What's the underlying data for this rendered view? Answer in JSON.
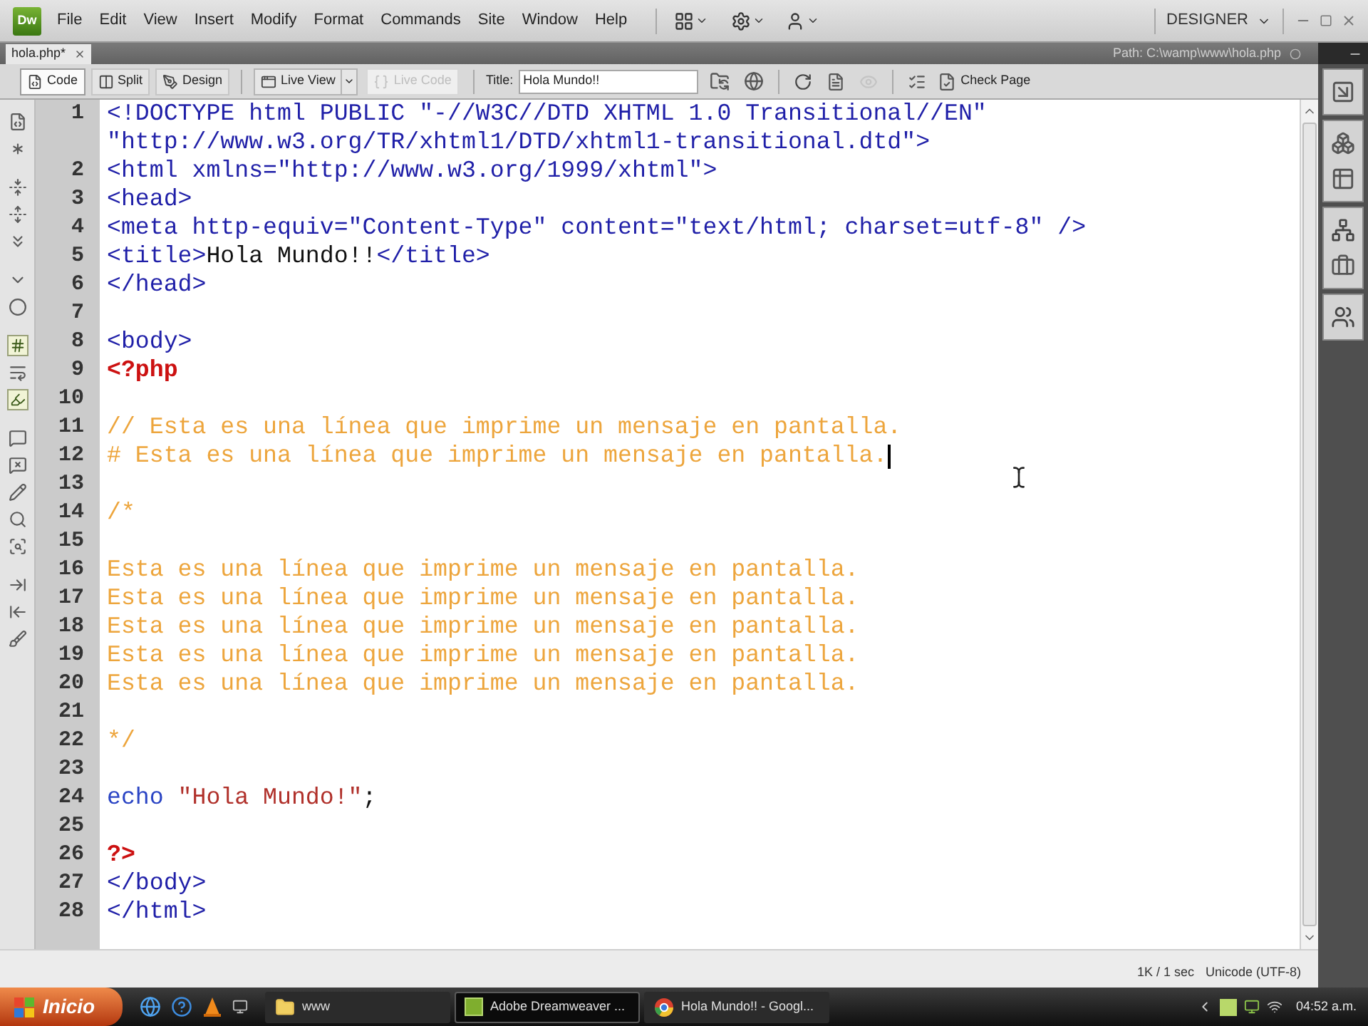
{
  "app": {
    "logo": "Dw",
    "menus": [
      "File",
      "Edit",
      "View",
      "Insert",
      "Modify",
      "Format",
      "Commands",
      "Site",
      "Window",
      "Help"
    ],
    "workspace": "DESIGNER"
  },
  "document": {
    "tab": "hola.php*",
    "path": "Path: C:\\wamp\\www\\hola.php"
  },
  "toolbar": {
    "views": [
      {
        "label": "Code",
        "selected": true
      },
      {
        "label": "Split",
        "selected": false
      },
      {
        "label": "Design",
        "selected": false
      }
    ],
    "buttons": [
      {
        "kind": "live-view",
        "label": "Live View",
        "disabled": false,
        "dropdown": true
      },
      {
        "kind": "live-code",
        "label": "Live Code",
        "disabled": true,
        "dropdown": false
      }
    ],
    "title_label": "Title:",
    "title_value": "Hola Mundo!!",
    "check_page": "Check Page"
  },
  "code_tools": [
    {
      "tools": [
        {
          "kind": "file",
          "on": false
        },
        {
          "kind": "asterisk",
          "on": false
        }
      ]
    },
    {
      "tools": [
        {
          "kind": "fold",
          "on": false
        },
        {
          "kind": "unfold",
          "on": false
        },
        {
          "kind": "expand",
          "on": false
        }
      ]
    },
    {
      "tools": [
        {
          "kind": "chevron",
          "on": false
        },
        {
          "kind": "circle",
          "on": false
        }
      ]
    },
    {
      "tools": [
        {
          "kind": "hash",
          "on": true
        },
        {
          "kind": "wrap",
          "on": false
        },
        {
          "kind": "highlight",
          "on": true
        }
      ]
    },
    {
      "tools": [
        {
          "kind": "comment",
          "on": false
        },
        {
          "kind": "uncomment",
          "on": false
        },
        {
          "kind": "pencil",
          "on": false
        },
        {
          "kind": "search",
          "on": false
        },
        {
          "kind": "scan",
          "on": false
        }
      ]
    },
    {
      "tools": [
        {
          "kind": "indent",
          "on": false
        },
        {
          "kind": "outdent",
          "on": false
        },
        {
          "kind": "brush",
          "on": false
        }
      ]
    }
  ],
  "code": {
    "rows": [
      {
        "number": "1",
        "caret": false,
        "segments": [
          {
            "kind": "tag",
            "text": "<!DOCTYPE html PUBLIC \"-//W3C//DTD XHTML 1.0 Transitional//EN\""
          }
        ]
      },
      {
        "caret": false,
        "segments": [
          {
            "kind": "tag",
            "text": "\"http://www.w3.org/TR/xhtml1/DTD/xhtml1-transitional.dtd\">"
          }
        ]
      },
      {
        "number": "2",
        "caret": false,
        "segments": [
          {
            "kind": "tag",
            "text": "<html xmlns=\"http://www.w3.org/1999/xhtml\">"
          }
        ]
      },
      {
        "number": "3",
        "caret": false,
        "segments": [
          {
            "kind": "tag",
            "text": "<head>"
          }
        ]
      },
      {
        "number": "4",
        "caret": false,
        "segments": [
          {
            "kind": "tag",
            "text": "<meta http-equiv=\"Content-Type\" content=\"text/html; charset=utf-8\" />"
          }
        ]
      },
      {
        "number": "5",
        "caret": false,
        "segments": [
          {
            "kind": "tag",
            "text": "<title>"
          },
          {
            "kind": "text",
            "text": "Hola Mundo!!"
          },
          {
            "kind": "tag",
            "text": "</title>"
          }
        ]
      },
      {
        "number": "6",
        "caret": false,
        "segments": [
          {
            "kind": "tag",
            "text": "</head>"
          }
        ]
      },
      {
        "number": "7",
        "caret": false
      },
      {
        "number": "8",
        "caret": false,
        "segments": [
          {
            "kind": "tag",
            "text": "<body>"
          }
        ]
      },
      {
        "number": "9",
        "caret": false,
        "segments": [
          {
            "kind": "php",
            "text": "<?php"
          }
        ]
      },
      {
        "number": "10",
        "caret": false
      },
      {
        "number": "11",
        "caret": false,
        "segments": [
          {
            "kind": "comment",
            "text": "// Esta es una línea que imprime un mensaje en pantalla."
          }
        ]
      },
      {
        "number": "12",
        "caret": true,
        "segments": [
          {
            "kind": "comment",
            "text": "# Esta es una línea que imprime un mensaje en pantalla."
          }
        ]
      },
      {
        "number": "13",
        "caret": false
      },
      {
        "number": "14",
        "caret": false,
        "segments": [
          {
            "kind": "comment",
            "text": "/*"
          }
        ]
      },
      {
        "number": "15",
        "caret": false
      },
      {
        "number": "16",
        "caret": false,
        "segments": [
          {
            "kind": "comment",
            "text": "Esta es una línea que imprime un mensaje en pantalla."
          }
        ]
      },
      {
        "number": "17",
        "caret": false,
        "segments": [
          {
            "kind": "comment",
            "text": "Esta es una línea que imprime un mensaje en pantalla."
          }
        ]
      },
      {
        "number": "18",
        "caret": false,
        "segments": [
          {
            "kind": "comment",
            "text": "Esta es una línea que imprime un mensaje en pantalla."
          }
        ]
      },
      {
        "number": "19",
        "caret": false,
        "segments": [
          {
            "kind": "comment",
            "text": "Esta es una línea que imprime un mensaje en pantalla."
          }
        ]
      },
      {
        "number": "20",
        "caret": false,
        "segments": [
          {
            "kind": "comment",
            "text": "Esta es una línea que imprime un mensaje en pantalla."
          }
        ]
      },
      {
        "number": "21",
        "caret": false
      },
      {
        "number": "22",
        "caret": false,
        "segments": [
          {
            "kind": "comment",
            "text": "*/"
          }
        ]
      },
      {
        "number": "23",
        "caret": false
      },
      {
        "number": "24",
        "caret": false,
        "segments": [
          {
            "kind": "keyword",
            "text": "echo "
          },
          {
            "kind": "string",
            "text": "\"Hola Mundo!\""
          },
          {
            "kind": "punct",
            "text": ";"
          }
        ]
      },
      {
        "number": "25",
        "caret": false
      },
      {
        "number": "26",
        "caret": false,
        "segments": [
          {
            "kind": "php",
            "text": "?>"
          }
        ]
      },
      {
        "number": "27",
        "caret": false,
        "segments": [
          {
            "kind": "tag",
            "text": "</body>"
          }
        ]
      },
      {
        "number": "28",
        "caret": false,
        "segments": [
          {
            "kind": "tag",
            "text": "</html>"
          }
        ]
      }
    ]
  },
  "status_bar": {
    "size": "1K / 1 sec",
    "encoding": "Unicode (UTF-8)"
  },
  "taskbar": {
    "start": "Inicio",
    "windows": [
      {
        "kind": "folder",
        "label": "www",
        "selected": false
      },
      {
        "kind": "editor",
        "label": "Adobe Dreamweaver ...",
        "selected": true
      },
      {
        "kind": "browser",
        "label": "Hola Mundo!! - Googl...",
        "selected": false
      }
    ],
    "clock": "04:52 a.m."
  }
}
